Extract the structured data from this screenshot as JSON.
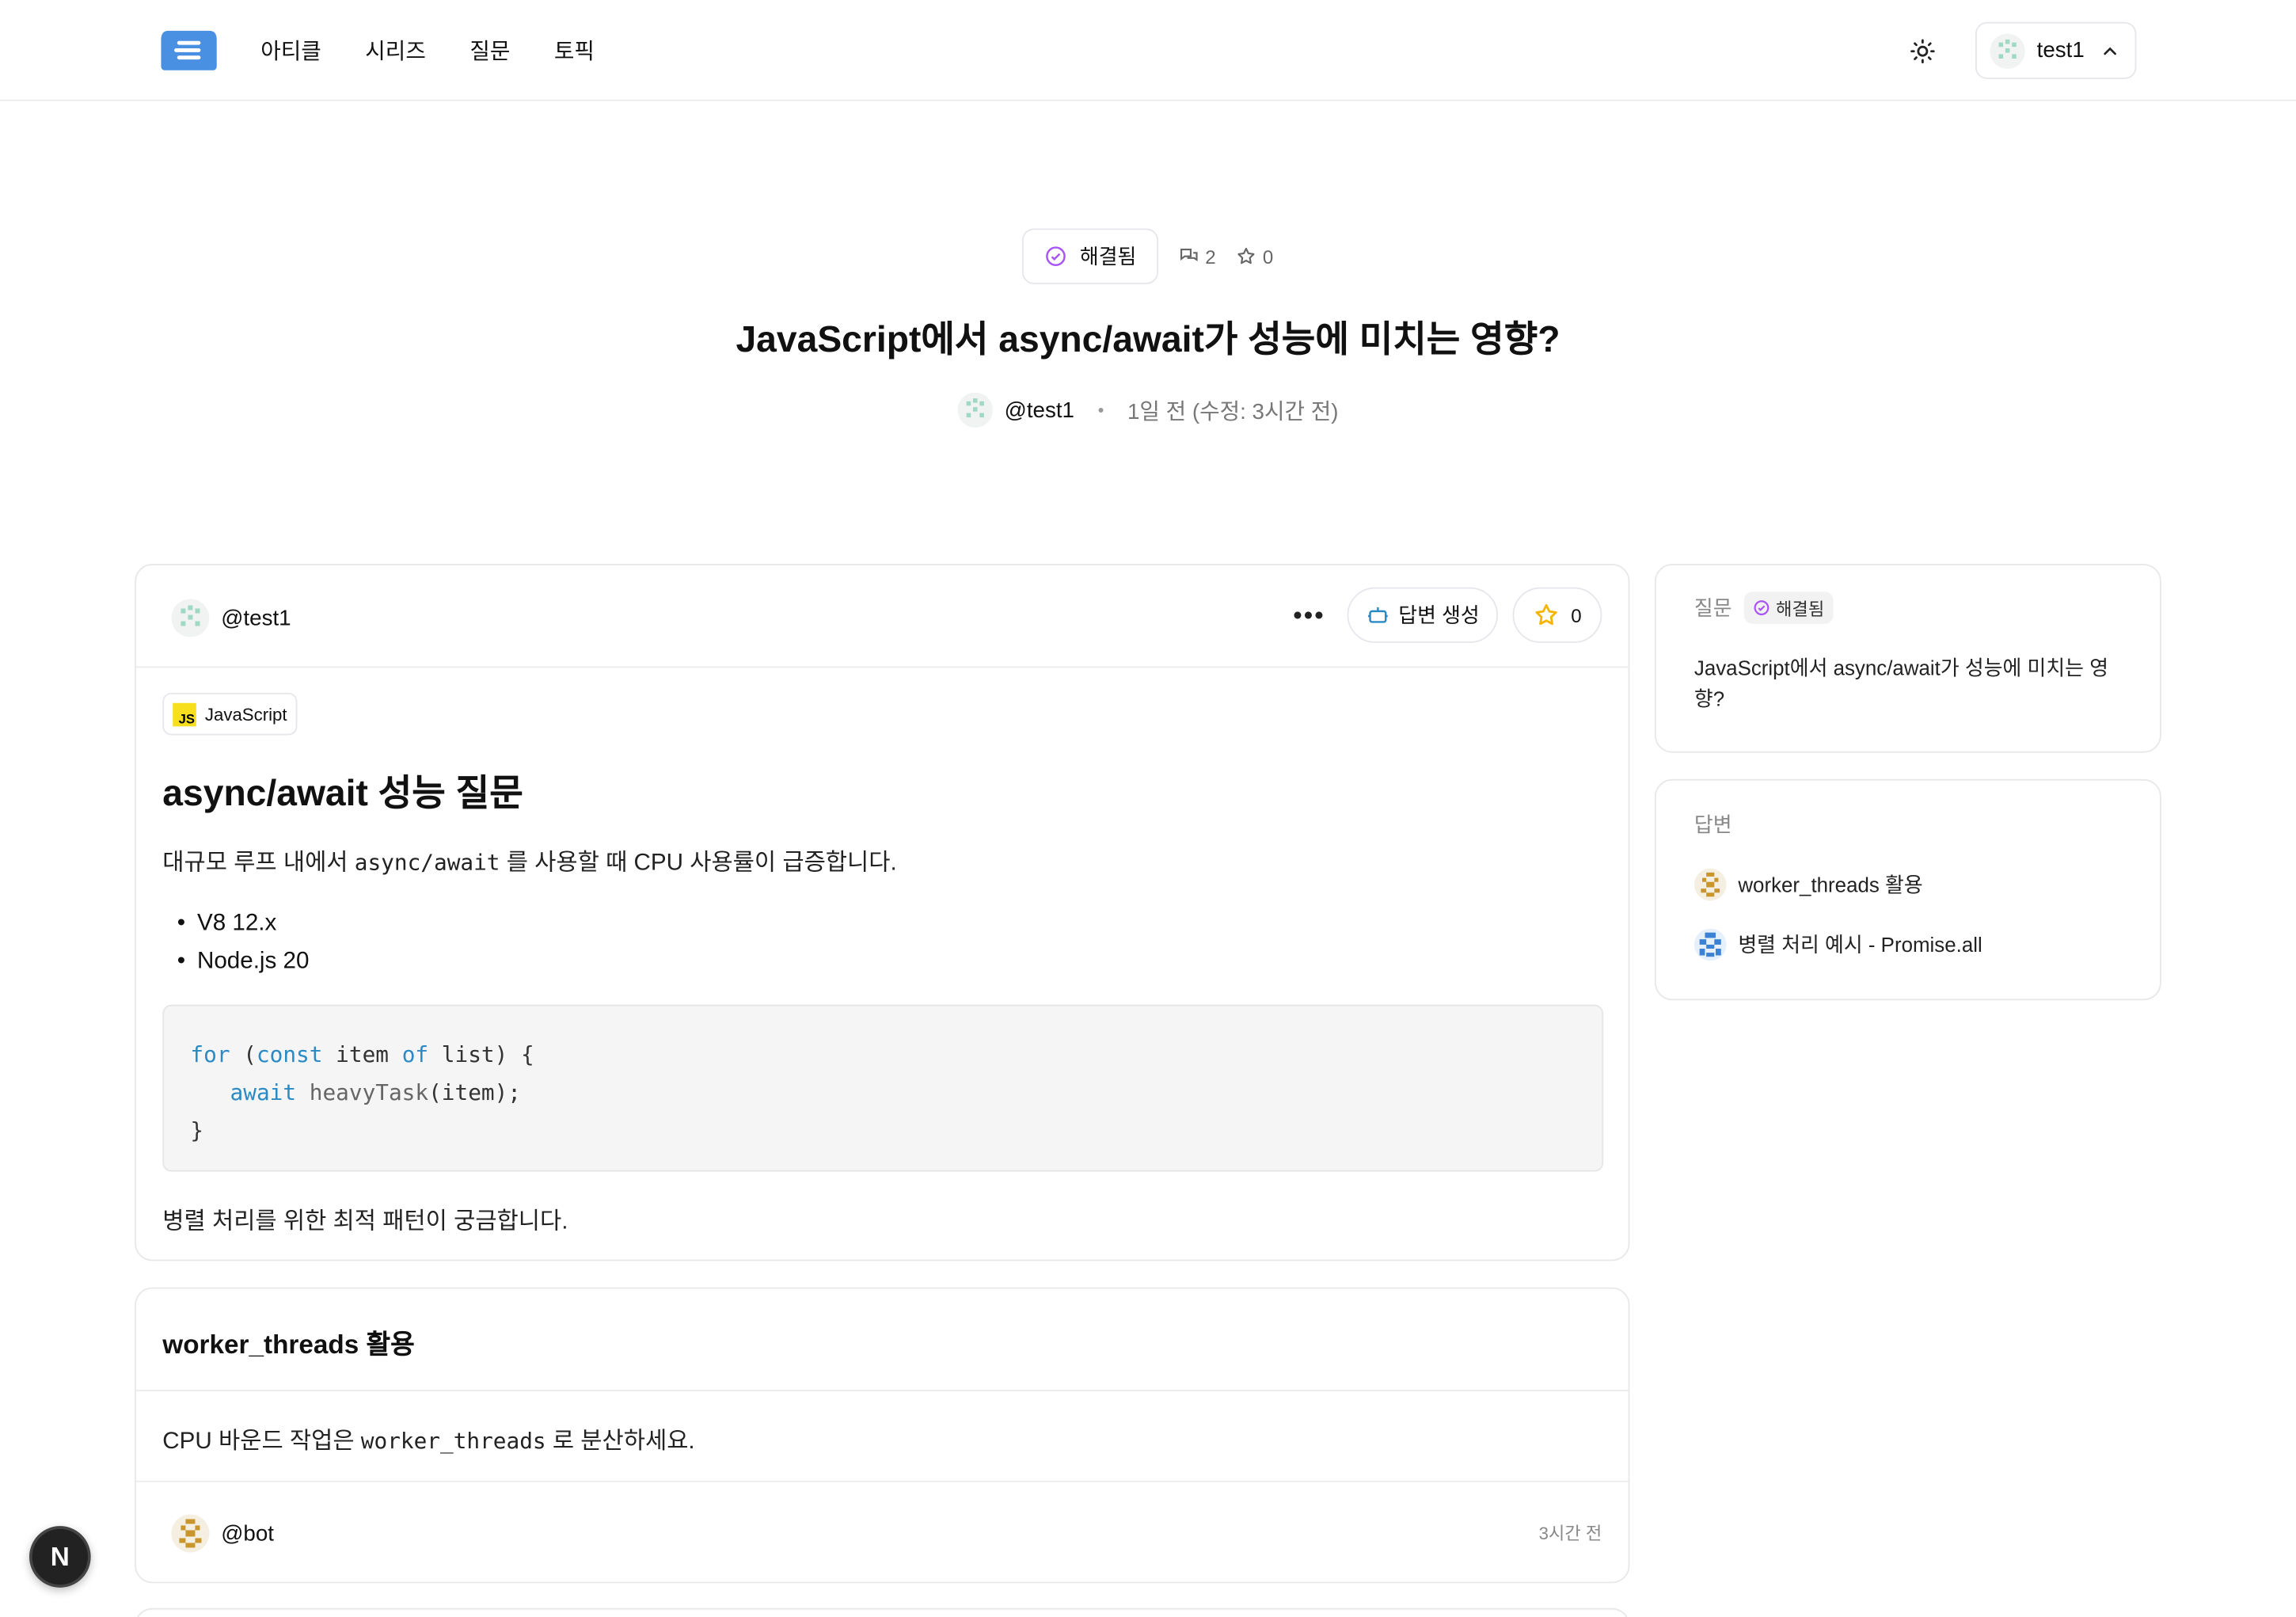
{
  "nav": {
    "items": [
      "아티클",
      "시리즈",
      "질문",
      "토픽"
    ]
  },
  "user": {
    "name": "test1"
  },
  "hero": {
    "status": "해결됨",
    "comments": "2",
    "stars": "0",
    "title": "JavaScript에서 async/await가 성능에 미치는 영향?",
    "author": "@test1",
    "time": "1일 전 (수정: 3시간 전)"
  },
  "question": {
    "author": "@test1",
    "generate_label": "답변 생성",
    "star_count": "0",
    "tag": "JavaScript",
    "tag_badge": "JS",
    "title": "async/await 성능 질문",
    "para_prefix": "대규모 루프 내에서 ",
    "para_code": "async/await",
    "para_suffix": " 를 사용할 때 CPU 사용률이 급증합니다.",
    "list": [
      "V8 12.x",
      "Node.js 20"
    ],
    "code": {
      "l1_kw1": "for",
      "l1_a": " (",
      "l1_kw2": "const",
      "l1_b": " item ",
      "l1_kw3": "of",
      "l1_c": " list) {",
      "l2_indent": "   ",
      "l2_kw": "await",
      "l2_fn": " heavyTask",
      "l2_rest": "(item);",
      "l3": "}"
    },
    "footer": "병렬 처리를 위한 최적 패턴이 궁금합니다."
  },
  "answer1": {
    "title": "worker_threads 활용",
    "text_prefix": "CPU 바운드 작업은 ",
    "text_code": "worker_threads",
    "text_suffix": " 로 분산하세요.",
    "author": "@bot",
    "time": "3시간 전"
  },
  "sidebar": {
    "question_label": "질문",
    "status": "해결됨",
    "question_title": "JavaScript에서 async/await가 성능에 미치는 영향?",
    "answers_label": "답변",
    "answers": [
      "worker_threads 활용",
      "병렬 처리 예시 - Promise.all"
    ]
  },
  "dev_badge": "N",
  "colors": {
    "accent": "#4a90e2",
    "solved": "#a855f7",
    "star": "#f5b400",
    "keyword": "#2b8ac4"
  }
}
